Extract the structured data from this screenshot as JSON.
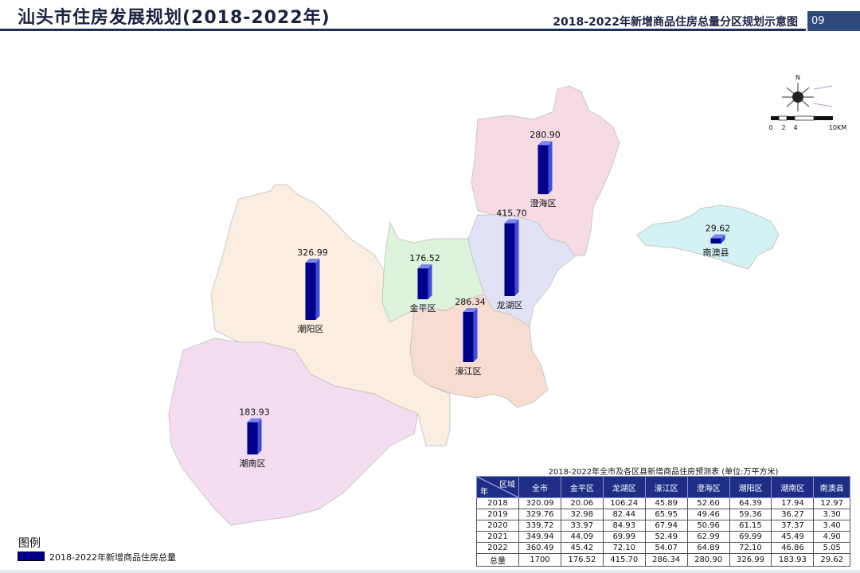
{
  "header": {
    "title": "汕头市住房发展规划(2018-2022年)",
    "subtitle": "2018-2022年新增商品住房总量分区规划示意图",
    "page_number": "09"
  },
  "compass": {
    "north": "N",
    "scale_ticks": [
      "0",
      "2",
      "4",
      "10KM"
    ]
  },
  "districts": [
    {
      "name": "澄海区",
      "value": "280.90",
      "color": "#f6dbe4"
    },
    {
      "name": "龙湖区",
      "value": "415.70",
      "color": "#e2e2f6"
    },
    {
      "name": "金平区",
      "value": "176.52",
      "color": "#ddf3dc"
    },
    {
      "name": "濠江区",
      "value": "286.34",
      "color": "#f7dcd2"
    },
    {
      "name": "潮阳区",
      "value": "326.99",
      "color": "#fbeee1"
    },
    {
      "name": "潮南区",
      "value": "183.93",
      "color": "#f4ddf1"
    },
    {
      "name": "南澳县",
      "value": "29.62",
      "color": "#d4f1f4"
    }
  ],
  "bar_color": "#00008b",
  "legend": {
    "title": "图例",
    "item": "2018-2022年新增商品住房总量"
  },
  "table": {
    "caption": "2018-2022年全市及各区县新增商品住房预测表 (单位:万平方米)",
    "corner_top": "区域",
    "corner_bottom": "年",
    "columns": [
      "全市",
      "金平区",
      "龙湖区",
      "濠江区",
      "澄海区",
      "潮阳区",
      "潮南区",
      "南澳县"
    ],
    "rows": [
      {
        "label": "2018",
        "cells": [
          "320.09",
          "20.06",
          "106.24",
          "45.89",
          "52.60",
          "64.39",
          "17.94",
          "12.97"
        ]
      },
      {
        "label": "2019",
        "cells": [
          "329.76",
          "32.98",
          "82.44",
          "65.95",
          "49.46",
          "59.36",
          "36.27",
          "3.30"
        ]
      },
      {
        "label": "2020",
        "cells": [
          "339.72",
          "33.97",
          "84.93",
          "67.94",
          "50.96",
          "61.15",
          "37.37",
          "3.40"
        ]
      },
      {
        "label": "2021",
        "cells": [
          "349.94",
          "44.09",
          "69.99",
          "52.49",
          "62.99",
          "69.99",
          "45.49",
          "4.90"
        ]
      },
      {
        "label": "2022",
        "cells": [
          "360.49",
          "45.42",
          "72.10",
          "54.07",
          "64.89",
          "72.10",
          "46.86",
          "5.05"
        ]
      },
      {
        "label": "总量",
        "cells": [
          "1700",
          "176.52",
          "415.70",
          "286.34",
          "280.90",
          "326.99",
          "183.93",
          "29.62"
        ]
      }
    ]
  }
}
